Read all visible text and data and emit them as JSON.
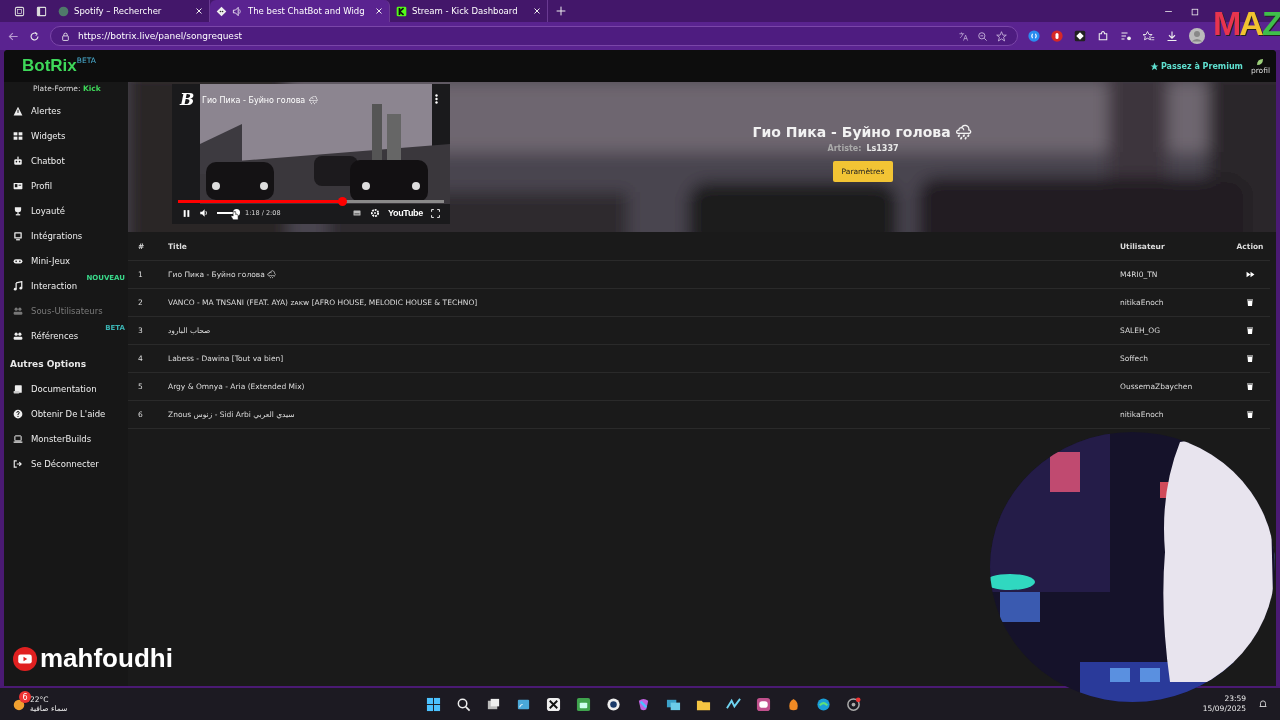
{
  "browser": {
    "tabs": [
      {
        "title": "Spotify – Rechercher",
        "selected": false,
        "playing_audio": false
      },
      {
        "title": "The best ChatBot and Widg",
        "selected": true,
        "playing_audio": true
      },
      {
        "title": "Stream - Kick Dashboard",
        "selected": false,
        "playing_audio": false
      }
    ],
    "url": "https://botrix.live/panel/songrequest"
  },
  "overlay_logo": [
    {
      "letter": "M",
      "color": "#e8344e"
    },
    {
      "letter": "A",
      "color": "#f2c230"
    },
    {
      "letter": "Z",
      "color": "#3fbf4a"
    }
  ],
  "app": {
    "logo": "BotRix",
    "logo_badge": "BETA",
    "premium": "Passez à Premium",
    "profile": "profil"
  },
  "sidebar": {
    "platform_label": "Plate-Forme:",
    "platform": "Kick",
    "items": [
      {
        "label": "Alertes",
        "disabled": false
      },
      {
        "label": "Widgets",
        "disabled": false
      },
      {
        "label": "Chatbot",
        "disabled": false
      },
      {
        "label": "Profil",
        "disabled": false
      },
      {
        "label": "Loyauté",
        "disabled": false
      },
      {
        "label": "Intégrations",
        "disabled": false
      },
      {
        "label": "Mini-Jeux",
        "disabled": false
      },
      {
        "label": "Interaction",
        "disabled": false,
        "badge": {
          "text": "NOUVEAU",
          "color": "#39d98a"
        }
      },
      {
        "label": "Sous-Utilisateurs",
        "disabled": true
      },
      {
        "label": "Références",
        "disabled": false,
        "badge": {
          "text": "BETA",
          "color": "#3bb3b3"
        }
      }
    ],
    "section_title": "Autres Options",
    "other_items": [
      {
        "label": "Documentation"
      },
      {
        "label": "Obtenir De L'aide"
      },
      {
        "label": "MonsterBuilds"
      },
      {
        "label": "Se Déconnecter"
      }
    ]
  },
  "video": {
    "title": "Гио Пика - Буйно голова 🌧",
    "channel_mark": "B",
    "progress": {
      "level": 0.62
    },
    "volume": {
      "level": 1
    },
    "time": "1:18 / 2:08",
    "brand": "YouTube"
  },
  "now_playing": {
    "title": "Гио Пика - Буйно голова 🌧",
    "artist_label": "Artiste:",
    "artist": "Ls1337",
    "button": "Paramètres"
  },
  "table": {
    "columns": [
      "#",
      "Title",
      "Utilisateur",
      "Action"
    ],
    "rows": [
      {
        "number": "1",
        "title": "Гио Пика - Буйно голова 🌧",
        "user": "M4RI0_TN",
        "kind": "skip"
      },
      {
        "number": "2",
        "title": "VANCO - MA TNSANI (FEAT. AYA) ᴢᴀᴋᴡ [AFRO HOUSE, MELODIC HOUSE & TECHNO]",
        "user": "nitikaEnoch",
        "kind": "delete"
      },
      {
        "number": "3",
        "title": "صحاب البارود",
        "user": "SALEH_OG",
        "kind": "delete"
      },
      {
        "number": "4",
        "title": "Labess - Dawina [Tout va bien]",
        "user": "Soffech",
        "kind": "delete"
      },
      {
        "number": "5",
        "title": "Argy & Omnya - Aria (Extended Mix)",
        "user": "OussemaZbaychen",
        "kind": "delete"
      },
      {
        "number": "6",
        "title": "Znous زنوس - Sidi Arbi سيدي العربي",
        "user": "nitikaEnoch",
        "kind": "delete"
      }
    ]
  },
  "stream_overlay": {
    "channel": "mahfoudhi"
  },
  "taskbar": {
    "weather": {
      "badge": "6",
      "temperature": "22°C",
      "condition": "سماء صافية"
    },
    "time": "23:59",
    "date": "15/09/2025"
  }
}
